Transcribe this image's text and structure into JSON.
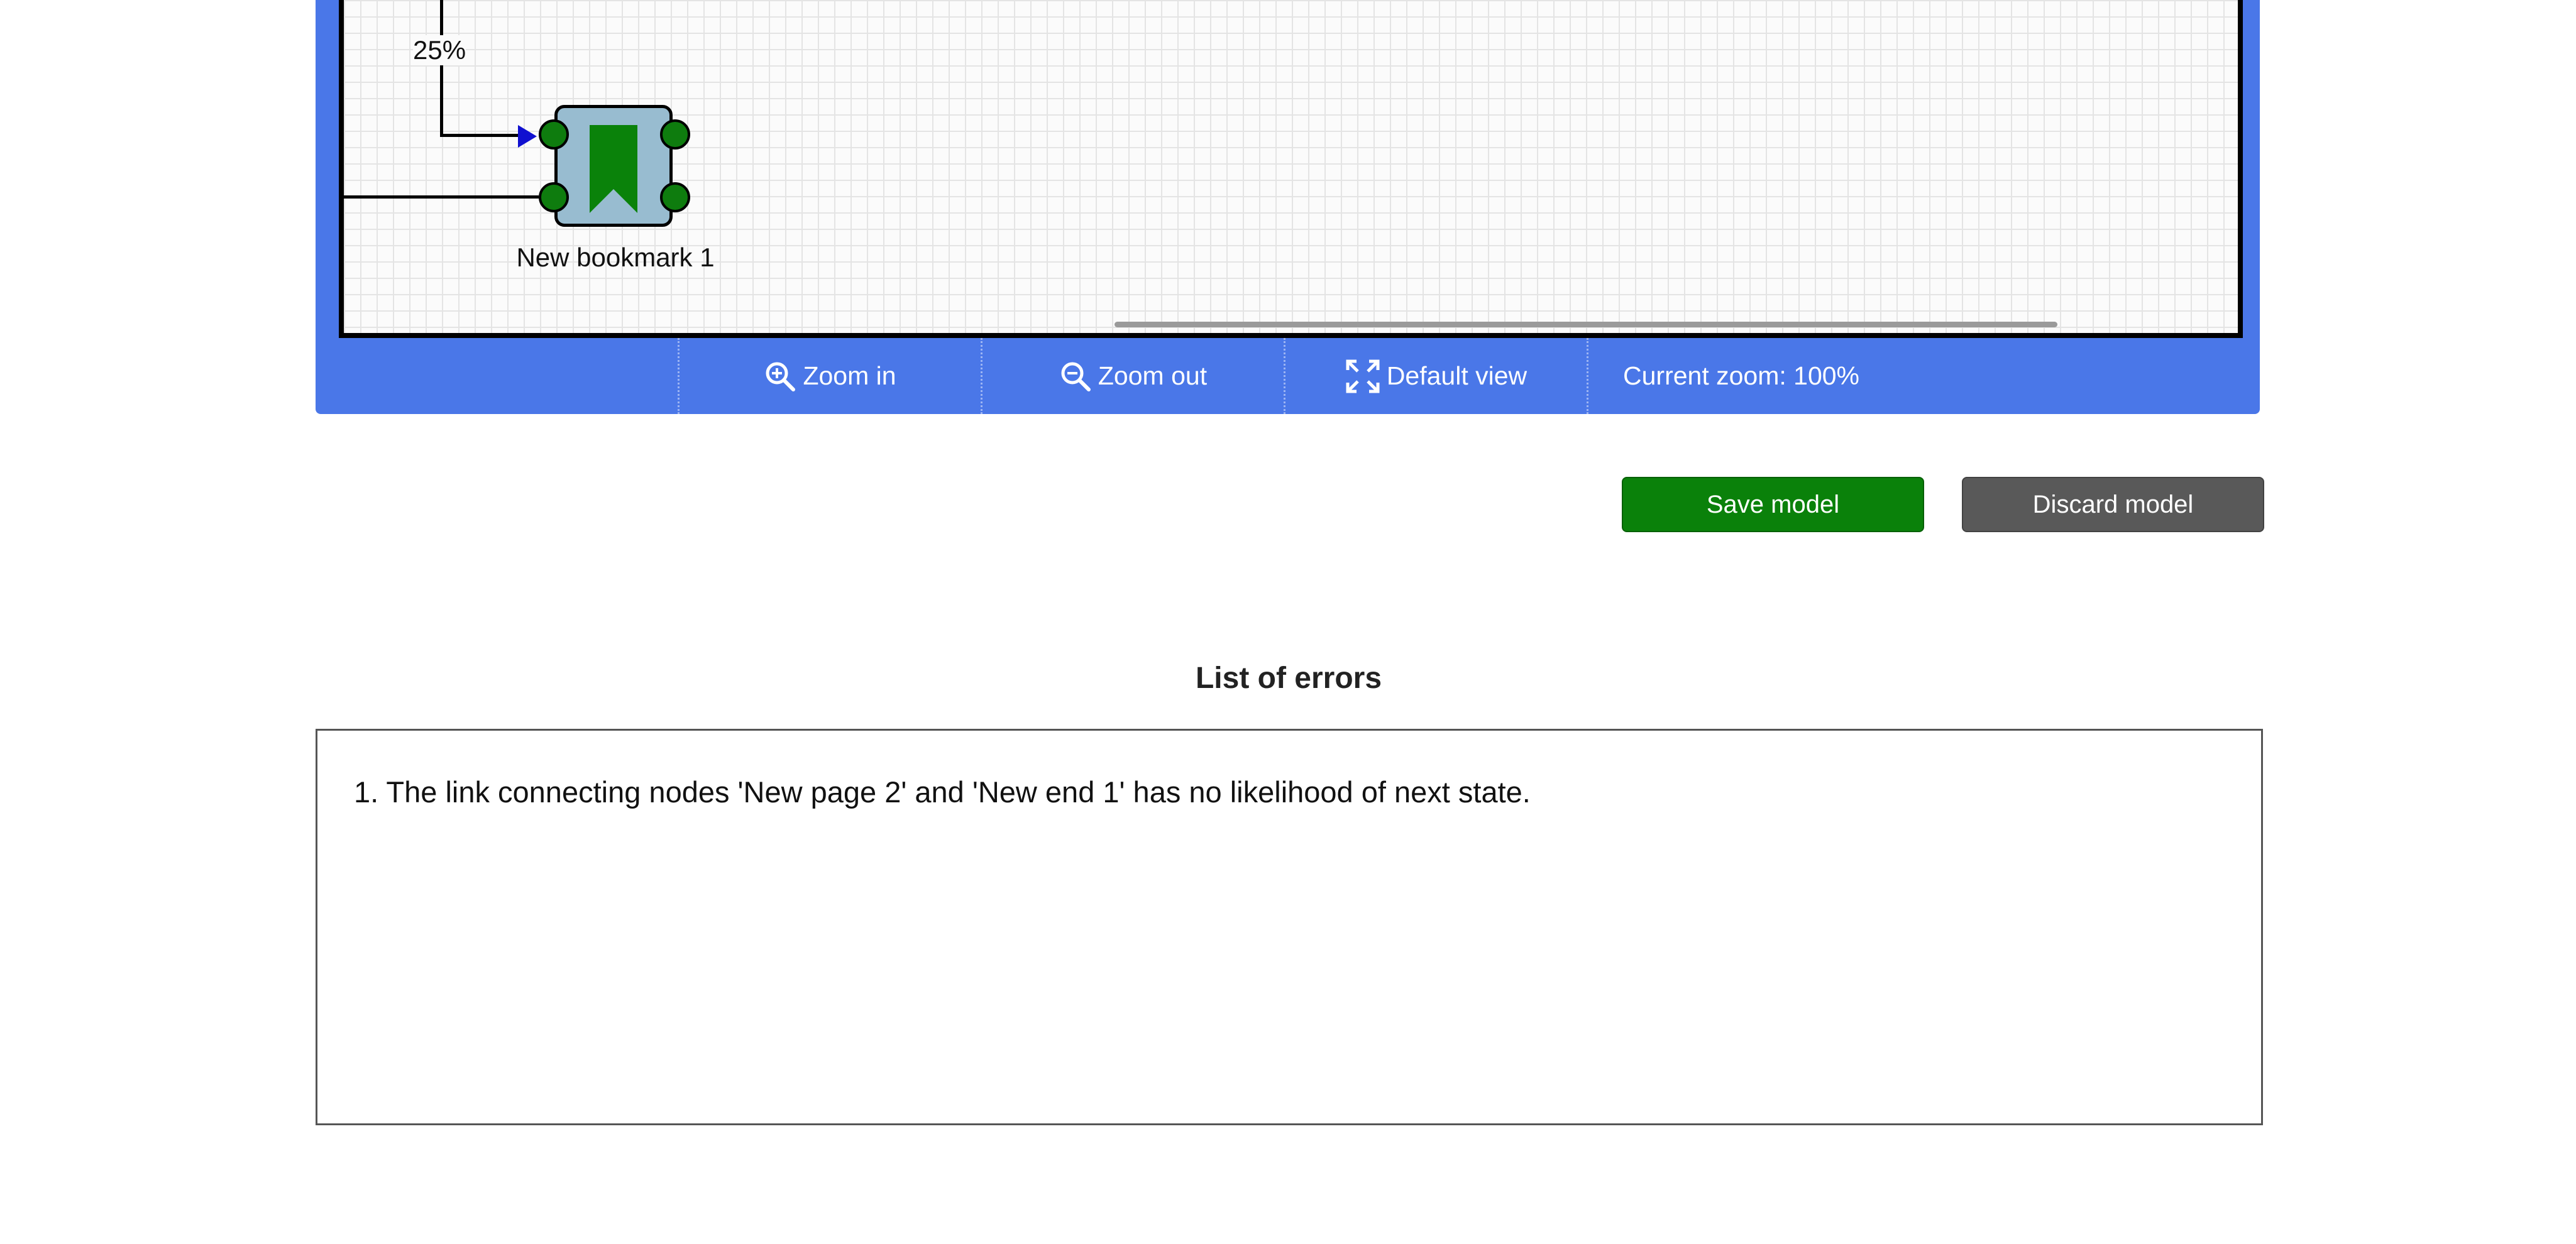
{
  "canvas": {
    "edge_probability_label": "25%",
    "node": {
      "label": "New bookmark 1",
      "icon": "bookmark-icon",
      "fill_color": "#98bcd0",
      "port_color": "#0e7c0e",
      "icon_color": "#0a820a"
    },
    "arrow_color": "#1010d0"
  },
  "toolbar": {
    "zoom_in_label": "Zoom in",
    "zoom_in_icon": "zoom-in-icon",
    "zoom_out_label": "Zoom out",
    "zoom_out_icon": "zoom-out-icon",
    "default_view_label": "Default view",
    "default_view_icon": "expand-icon",
    "current_zoom_label": "Current zoom: 100%",
    "background_color": "#4a77e8"
  },
  "actions": {
    "save_label": "Save model",
    "save_color": "#0a810a",
    "discard_label": "Discard model",
    "discard_color": "#595959"
  },
  "errors": {
    "title": "List of errors",
    "items": [
      "1. The link connecting nodes 'New page 2' and 'New end 1' has no likelihood of next state."
    ]
  }
}
